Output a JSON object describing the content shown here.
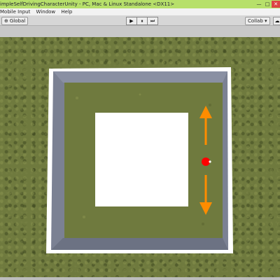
{
  "window": {
    "title": "impleSelfDrivingCharacterUnity - PC, Mac & Linux Standalone <DX11>",
    "minimize": "—",
    "maximize": "□",
    "close": "✕"
  },
  "menu": {
    "items": [
      "Mobile Input",
      "Window",
      "Help"
    ]
  },
  "toolbar": {
    "global_label": "Global",
    "global_icon": "globe-icon",
    "play_icon": "▶",
    "pause_icon": "⏸",
    "step_icon": "⏭",
    "collab_label": "Collab ▾",
    "cloud_icon": "☁"
  },
  "scene": {
    "ground_color": "#6f7a3e",
    "track_color": "#7b8193",
    "border_color": "#ffffff",
    "center_block_color": "#ffffff",
    "agent_color": "#ff0000",
    "arrow_color": "#ff8c00"
  }
}
